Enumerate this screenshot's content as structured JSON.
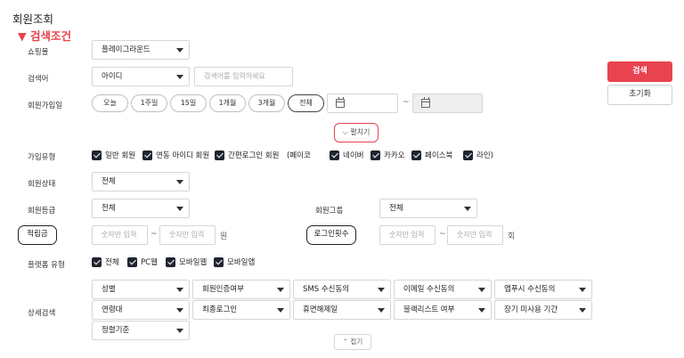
{
  "page": {
    "title": "회원조회",
    "section_title": "▼ 검색조건"
  },
  "filters": {
    "shopping_mall": {
      "label": "쇼핑몰",
      "value": "플레이그라운드"
    },
    "search_keyword": {
      "label": "검색어",
      "type_value": "아이디",
      "placeholder": "검색어를 입력하세요"
    },
    "join_date": {
      "label": "회원가입일",
      "ranges": [
        "오늘",
        "1주일",
        "15일",
        "1개월",
        "3개월",
        "전체"
      ],
      "active_range": "전체",
      "separator": "~"
    },
    "expand_label": "⌵ 펼치기",
    "join_type": {
      "label": "가입유형",
      "options": [
        "일반 회원",
        "연동 아이디 회원",
        "간편로그인 회원",
        "(페이코",
        "네이버",
        "카카오",
        "페이스북",
        "라인)"
      ]
    },
    "member_status": {
      "label": "회원상태",
      "value": "전체"
    },
    "member_grade": {
      "label": "회원등급",
      "value": "전체"
    },
    "member_group": {
      "label": "회원그룹",
      "value": "전체"
    },
    "points": {
      "label": "적립금",
      "min_placeholder": "숫자만 입력",
      "max_placeholder": "숫자만 입력",
      "separator": "~",
      "unit": "원"
    },
    "login_count": {
      "label": "로그인횟수",
      "min_placeholder": "숫자만 입력",
      "max_placeholder": "숫자만 입력",
      "separator": "~",
      "unit": "회"
    },
    "platform_type": {
      "label": "플랫폼 유형",
      "options": [
        "전체",
        "PC웹",
        "모바일웹",
        "모바일앱"
      ]
    },
    "detail_search": {
      "label": "상세검색",
      "row1": [
        "성별",
        "회원인증여부",
        "SMS 수신동의",
        "이메일 수신동의",
        "앱푸시 수신동의"
      ],
      "row2": [
        "연령대",
        "최종로그인",
        "휴면해제일",
        "블랙리스트 여부",
        "장기 미사용 기간"
      ],
      "row3": [
        "정렬기준"
      ]
    },
    "collapse_label": "⌃ 접기"
  },
  "actions": {
    "search_label": "검색",
    "reset_label": "초기화"
  },
  "colors": {
    "accent": "#e8434f",
    "checkbox": "#1f2430"
  }
}
